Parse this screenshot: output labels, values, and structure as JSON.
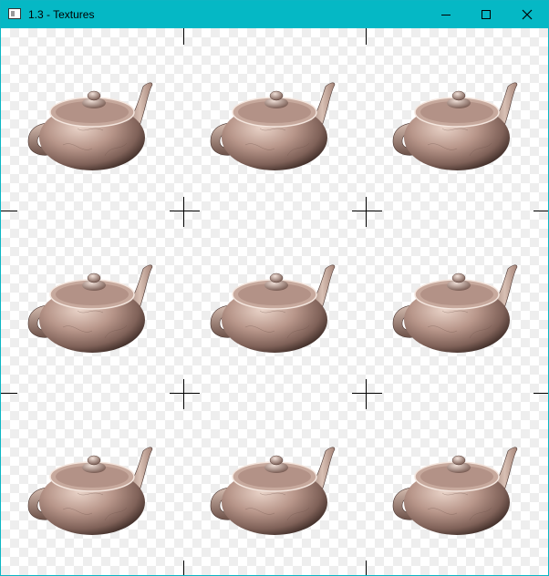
{
  "window": {
    "title": "1.3 - Textures",
    "icon": "app-window-icon",
    "controls": [
      "minimize-icon",
      "maximize-icon",
      "close-icon"
    ]
  },
  "viewport": {
    "content": "teapot-grid",
    "rows": 3,
    "columns": 3,
    "background": "checkerboard",
    "colors": {
      "titlebar": "#05b8c5",
      "checker_light": "#ffffff",
      "checker_dark": "#eeeeee",
      "teapot_base": "#9a7a6e",
      "teapot_highlight": "#e6cfc4"
    }
  }
}
